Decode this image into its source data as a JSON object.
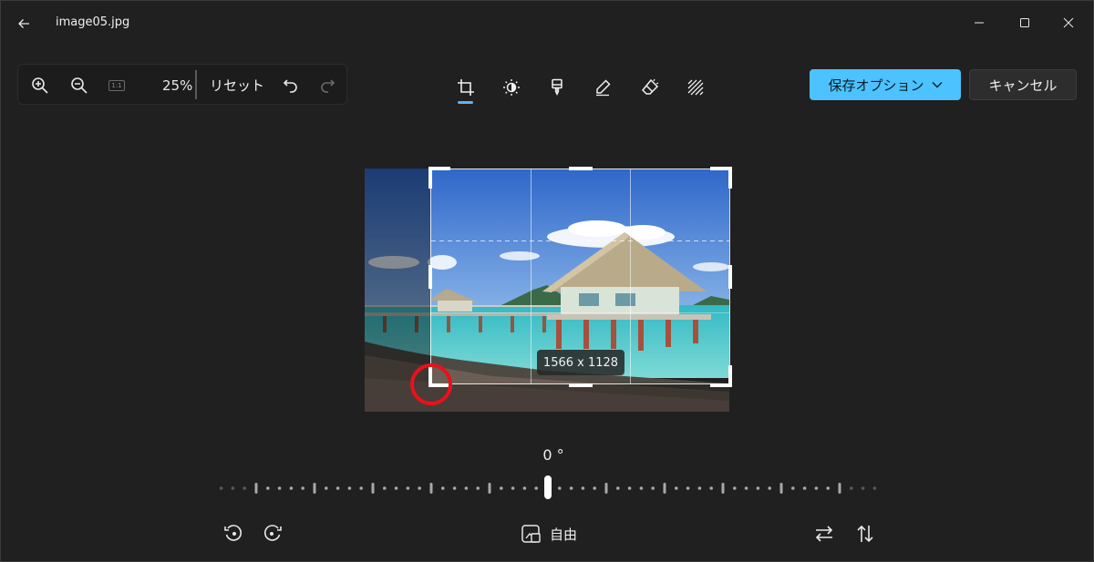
{
  "window": {
    "title": "image05.jpg",
    "back_icon": "back-arrow-icon",
    "controls": [
      "minimize-icon",
      "maximize-icon",
      "close-icon"
    ]
  },
  "toolbar": {
    "zoom_in_icon": "zoom-in-icon",
    "zoom_out_icon": "zoom-out-icon",
    "actual_size_label": "1:1",
    "zoom_value": "25%",
    "reset_label": "リセット",
    "undo_icon": "undo-icon",
    "redo_icon": "redo-icon",
    "tools": [
      {
        "name": "crop",
        "icon": "crop-icon",
        "active": true
      },
      {
        "name": "adjust",
        "icon": "brightness-icon",
        "active": false
      },
      {
        "name": "filter",
        "icon": "filter-brush-icon",
        "active": false
      },
      {
        "name": "markup",
        "icon": "pen-icon",
        "active": false
      },
      {
        "name": "erase",
        "icon": "eraser-icon",
        "active": false
      },
      {
        "name": "background",
        "icon": "background-blur-icon",
        "active": false
      }
    ],
    "save_label": "保存オプション",
    "cancel_label": "キャンセル"
  },
  "canvas": {
    "crop_size": "1566 x 1128"
  },
  "rotation": {
    "angle": "0 °",
    "value_degrees": 0
  },
  "bottom": {
    "rotate_left_icon": "rotate-left-icon",
    "rotate_right_icon": "rotate-right-icon",
    "aspect_label": "自由",
    "aspect_icon": "aspect-ratio-icon",
    "flip_horizontal_icon": "flip-horizontal-icon",
    "flip_vertical_icon": "flip-vertical-icon"
  },
  "colors": {
    "accent": "#4cc2ff",
    "background": "#202020",
    "annotation": "#e8121b"
  }
}
